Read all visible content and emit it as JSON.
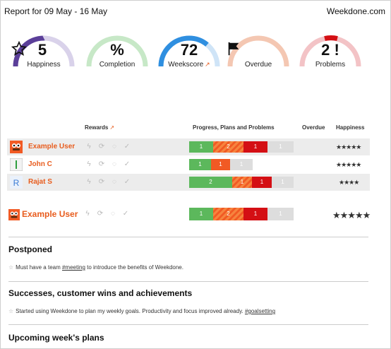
{
  "header": {
    "report_title": "Report for 09 May - 16 May",
    "brand": "Weekdone.com"
  },
  "gauges": [
    {
      "value": "5",
      "label": "Happiness",
      "icon": "star-outline-icon",
      "color": "#5b3f99",
      "fill": 0.5
    },
    {
      "value": "%",
      "label": "Completion",
      "icon": "",
      "color": "#c7e8c7",
      "fill": 0.0
    },
    {
      "value": "72",
      "label": "Weekscore",
      "icon": "",
      "color": "#2f8fe0",
      "fill": 0.72,
      "external_link": true
    },
    {
      "value": "",
      "label": "Overdue",
      "icon": "flag-icon",
      "color": "#f4c7b2",
      "fill": 0.0
    },
    {
      "value": "2 !",
      "label": "Problems",
      "icon": "",
      "color": "#f3c3c6",
      "fill": 0.12,
      "accent": "#d40f14"
    }
  ],
  "table": {
    "headers": {
      "rewards": "Rewards",
      "progress": "Progress, Plans and Problems",
      "overdue": "Overdue",
      "happiness": "Happiness"
    },
    "rows": [
      {
        "name": "Example User",
        "avatar": "monster-avatar-icon",
        "segments": [
          {
            "label": "1",
            "kind": "green",
            "share": 0.23
          },
          {
            "label": "2",
            "kind": "stripe",
            "share": 0.29
          },
          {
            "label": "1",
            "kind": "red",
            "share": 0.23
          },
          {
            "label": "1",
            "kind": "grey",
            "share": 0.25
          }
        ],
        "happiness": "★★★★★"
      },
      {
        "name": "John C",
        "avatar": "john-avatar-icon",
        "segments": [
          {
            "label": "1",
            "kind": "green",
            "share": 0.35
          },
          {
            "label": "1",
            "kind": "orange",
            "share": 0.3
          },
          {
            "label": "1",
            "kind": "grey",
            "share": 0.35
          }
        ],
        "happiness": "★★★★★"
      },
      {
        "name": "Rajat S",
        "avatar": "rajat-avatar-icon",
        "segments": [
          {
            "label": "2",
            "kind": "green",
            "share": 0.41
          },
          {
            "label": "1",
            "kind": "stripe",
            "share": 0.19
          },
          {
            "label": "1",
            "kind": "red",
            "share": 0.19
          },
          {
            "label": "1",
            "kind": "grey",
            "share": 0.21
          }
        ],
        "happiness": "★★★★"
      }
    ]
  },
  "summary_user": {
    "name": "Example User",
    "segments": [
      {
        "label": "1",
        "kind": "green",
        "share": 0.23
      },
      {
        "label": "2",
        "kind": "stripe",
        "share": 0.29
      },
      {
        "label": "1",
        "kind": "red",
        "share": 0.23
      },
      {
        "label": "1",
        "kind": "grey",
        "share": 0.25
      }
    ],
    "happiness": "★★★★★"
  },
  "sections": [
    {
      "title": "Postponed",
      "items": [
        {
          "pre": "Must have a team ",
          "tag": "#meeting",
          "post": " to introduce the benefits of Weekdone."
        }
      ]
    },
    {
      "title": "Successes, customer wins and achievements",
      "items": [
        {
          "pre": "Started using Weekdone to plan my weekly goals. Productivity and focus improved already. ",
          "tag": "#goalsetting",
          "post": ""
        }
      ]
    },
    {
      "title": "Upcoming week's plans",
      "items": []
    }
  ],
  "colors": {
    "brand_orange": "#e85c1d",
    "green": "#5cb85c",
    "orange": "#f15a24",
    "red": "#d40f14",
    "grey": "#dddddd"
  }
}
